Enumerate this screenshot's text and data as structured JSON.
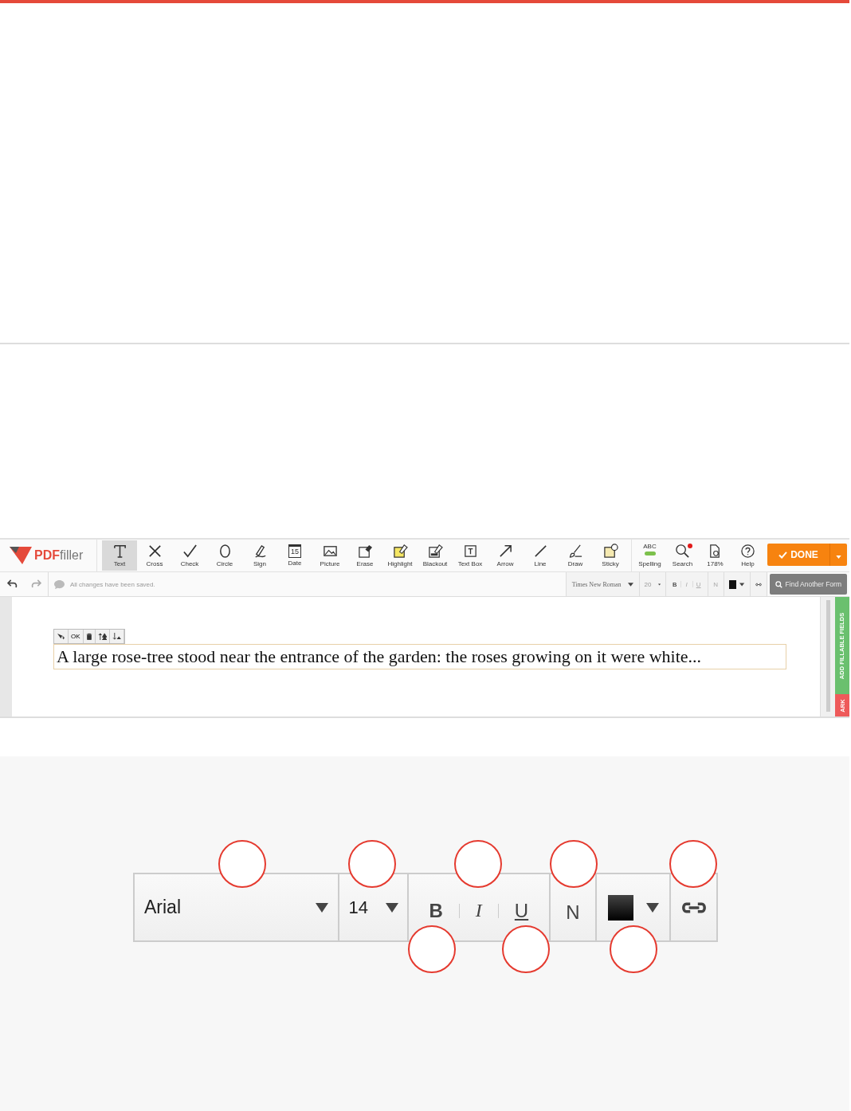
{
  "editor": {
    "logo": {
      "brand": "PDF",
      "suffix": "filler"
    },
    "tools": [
      {
        "label": "Text",
        "kind": "text",
        "selected": true
      },
      {
        "label": "Cross",
        "kind": "cross",
        "selected": false
      },
      {
        "label": "Check",
        "kind": "check",
        "selected": false
      },
      {
        "label": "Circle",
        "kind": "circle",
        "selected": false
      },
      {
        "label": "Sign",
        "kind": "sign",
        "selected": false
      },
      {
        "label": "Date",
        "kind": "date",
        "selected": false
      },
      {
        "label": "Picture",
        "kind": "picture",
        "selected": false
      },
      {
        "label": "Erase",
        "kind": "erase",
        "selected": false
      },
      {
        "label": "Highlight",
        "kind": "highlight",
        "selected": false
      },
      {
        "label": "Blackout",
        "kind": "blackout",
        "selected": false
      },
      {
        "label": "Text Box",
        "kind": "textbox",
        "selected": false
      },
      {
        "label": "Arrow",
        "kind": "arrow",
        "selected": false
      },
      {
        "label": "Line",
        "kind": "line",
        "selected": false
      },
      {
        "label": "Draw",
        "kind": "draw",
        "selected": false
      },
      {
        "label": "Sticky",
        "kind": "sticky",
        "selected": false
      }
    ],
    "right_tools": [
      {
        "label": "Spelling",
        "kind": "spelling",
        "badge": false
      },
      {
        "label": "Search",
        "kind": "search",
        "badge": true
      },
      {
        "label": "178%",
        "kind": "zoom",
        "badge": false
      },
      {
        "label": "Help",
        "kind": "help",
        "badge": false
      }
    ],
    "spelling_caption": "ABC",
    "date_digits": "15",
    "done_button": "DONE",
    "status": "All changes have been saved.",
    "format_bar": {
      "font": "Times New Roman",
      "size": "20",
      "bold": "B",
      "italic": "I",
      "underline": "U",
      "normal": "N"
    },
    "find_button": "Find Another Form",
    "document": {
      "mini_toolbar": {
        "ok": "OK"
      },
      "text": "A large rose-tree stood near the entrance of the garden: the roses growing on it were white...",
      "side_tabs": [
        {
          "label": "ADD FILLABLE FIELDS",
          "kind": "fields"
        },
        {
          "label": "ARK",
          "kind": "mark"
        }
      ]
    }
  },
  "zoomed_format_bar": {
    "font": "Arial",
    "size": "14",
    "bold": "B",
    "italic": "I",
    "underline": "U",
    "normal": "N"
  }
}
